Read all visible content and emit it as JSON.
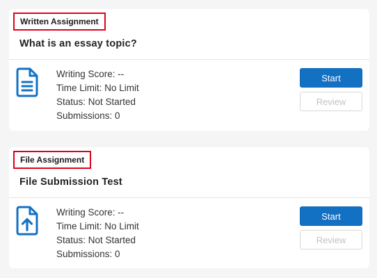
{
  "assignments": [
    {
      "type_label": "Written Assignment",
      "title": "What is an essay topic?",
      "icon": "document-lines-icon",
      "writing_score": "Writing Score: --",
      "time_limit": "Time Limit: No Limit",
      "status": "Status: Not Started",
      "submissions": "Submissions: 0",
      "start_label": "Start",
      "review_label": "Review"
    },
    {
      "type_label": "File Assignment",
      "title": "File Submission Test",
      "icon": "file-upload-icon",
      "writing_score": "Writing Score: --",
      "time_limit": "Time Limit: No Limit",
      "status": "Status: Not Started",
      "submissions": "Submissions: 0",
      "start_label": "Start",
      "review_label": "Review"
    }
  ],
  "colors": {
    "primary": "#1371c4",
    "highlight_border": "#e0001b",
    "page_background": "#f5f5f5"
  }
}
